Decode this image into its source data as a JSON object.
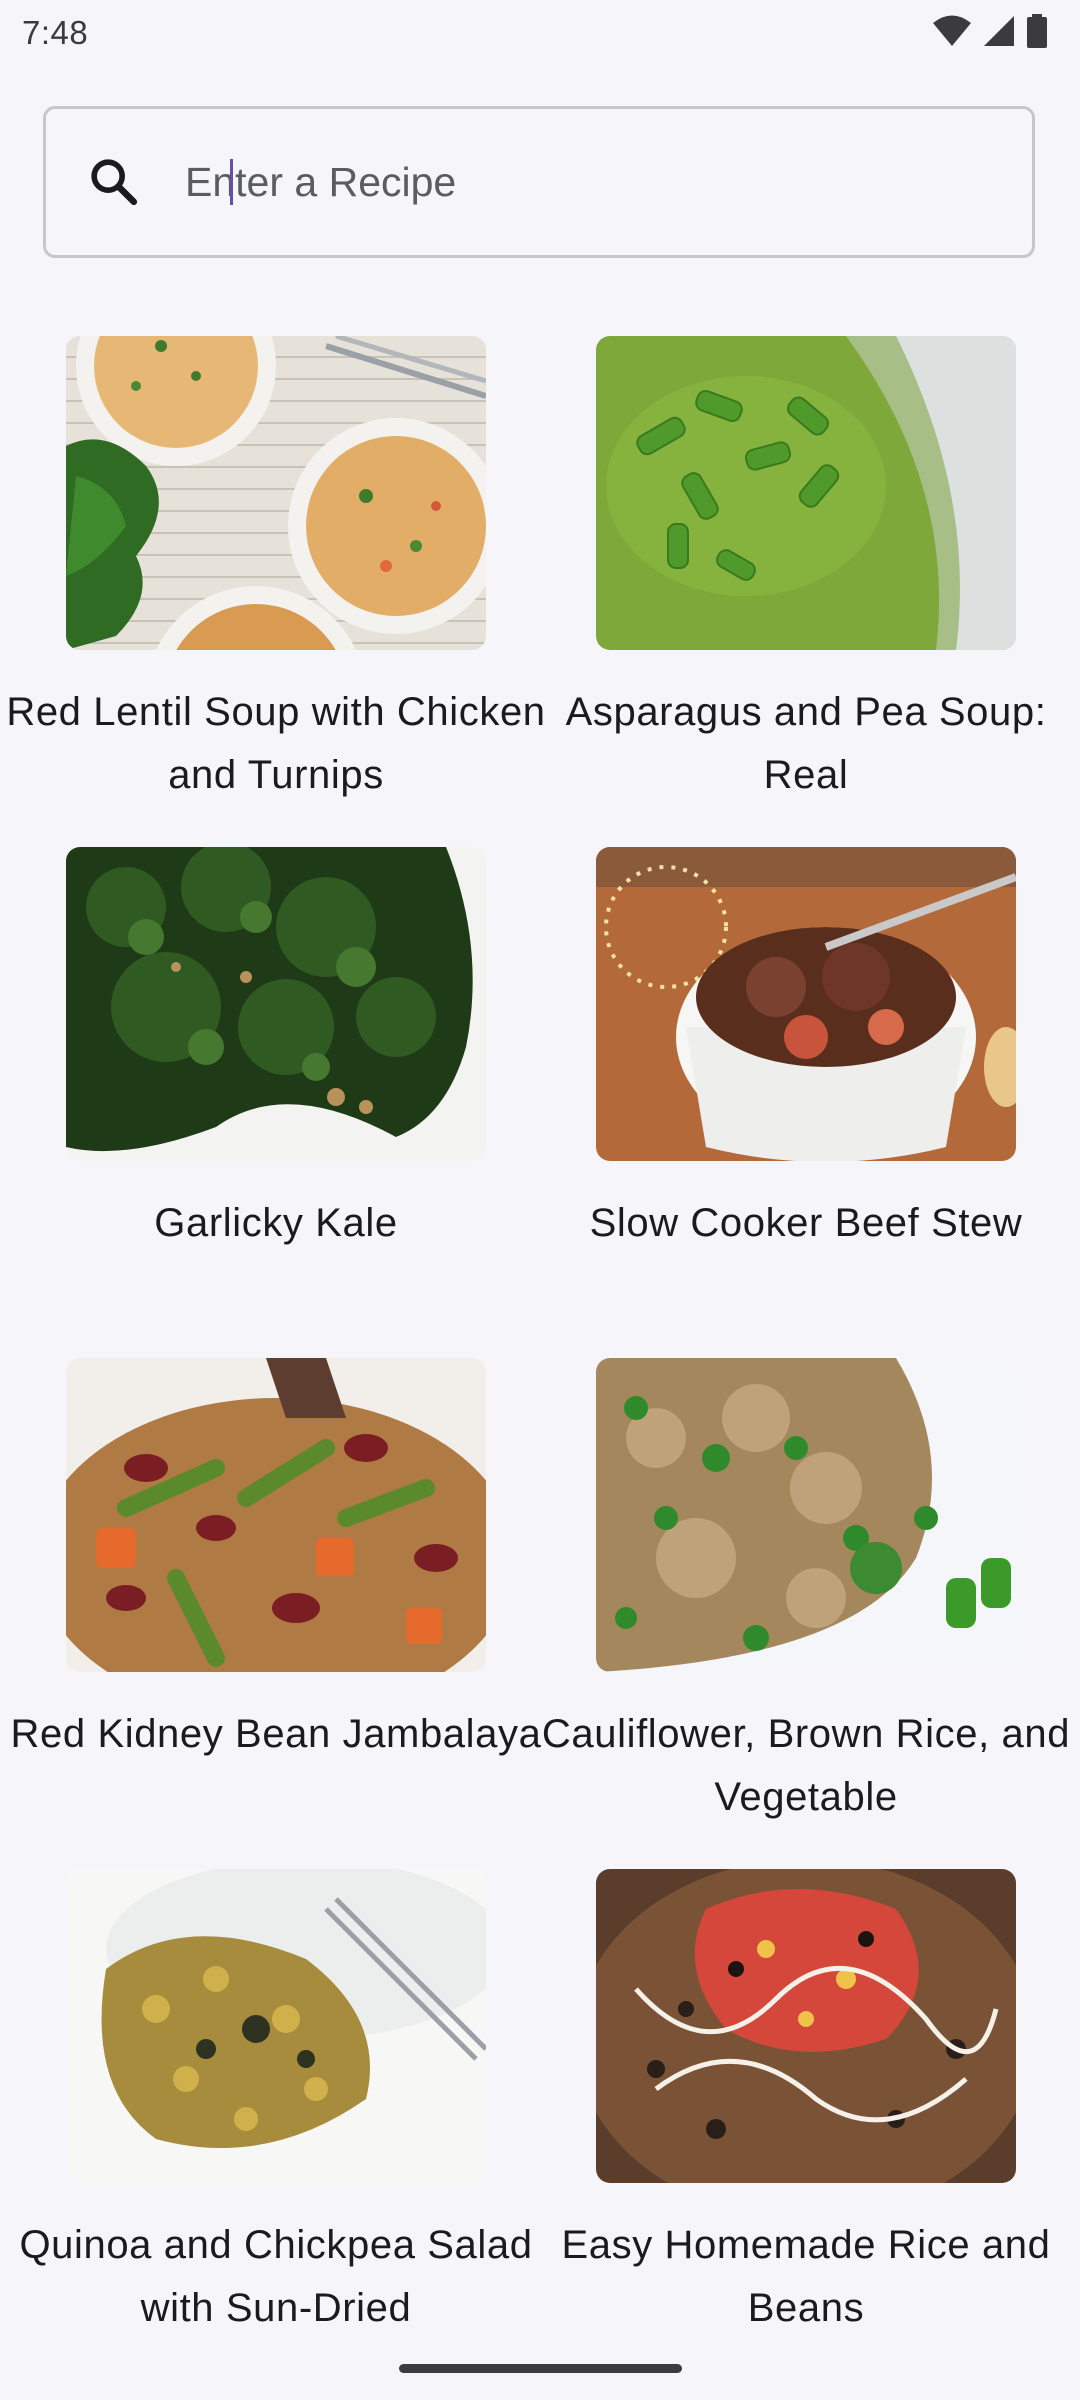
{
  "status_bar": {
    "time": "7:48",
    "icons": [
      "wifi-icon",
      "cellular-signal-icon",
      "battery-icon"
    ]
  },
  "search": {
    "placeholder": "Enter a Recipe",
    "value": "",
    "icon": "search-icon"
  },
  "recipes": [
    {
      "title": "Red Lentil Soup with Chicken and Turnips"
    },
    {
      "title": "Asparagus and Pea Soup: Real"
    },
    {
      "title": "Garlicky Kale"
    },
    {
      "title": "Slow Cooker Beef Stew"
    },
    {
      "title": "Red Kidney Bean Jambalaya"
    },
    {
      "title": "Cauliflower, Brown Rice, and Vegetable"
    },
    {
      "title": "Quinoa and Chickpea Salad with Sun-Dried"
    },
    {
      "title": "Easy Homemade Rice and Beans"
    }
  ],
  "colors": {
    "background": "#f6f5fa",
    "outline": "#c6c6cc",
    "text": "#1b1b1f",
    "caret": "#6750a4"
  }
}
